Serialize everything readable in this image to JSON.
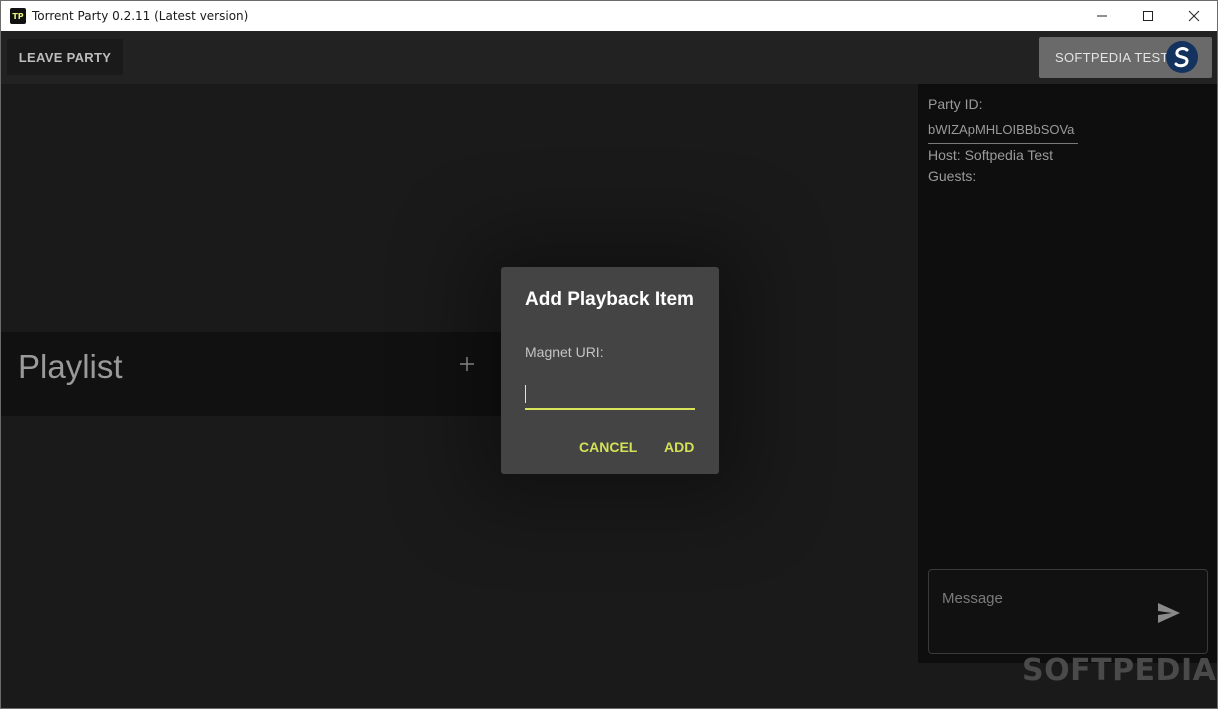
{
  "window": {
    "title": "Torrent Party 0.2.11 (Latest version)",
    "icon_text": "TP"
  },
  "appbar": {
    "leave_label": "LEAVE PARTY",
    "user_label": "SOFTPEDIA TEST"
  },
  "playlist": {
    "title": "Playlist"
  },
  "sidebar": {
    "party_id_label": "Party ID:",
    "party_id_value": "bWIZApMHLOIBBbSOVa",
    "host": "Host: Softpedia Test",
    "guests": "Guests:",
    "message_placeholder": "Message"
  },
  "dialog": {
    "title": "Add Playback Item",
    "field_label": "Magnet URI:",
    "cancel_label": "CANCEL",
    "add_label": "ADD"
  },
  "watermark": {
    "text": "SOFTPEDIA",
    "mark": "®"
  },
  "colors": {
    "accent": "#d4e157",
    "background": "#1b1b1b",
    "dialog": "#444444"
  }
}
